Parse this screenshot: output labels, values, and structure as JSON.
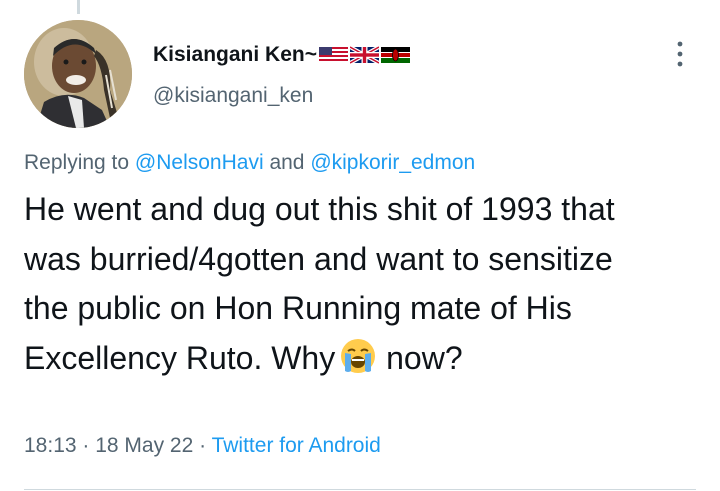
{
  "author": {
    "display_name": "Kisiangani Ken~",
    "handle": "@kisiangani_ken",
    "flags": [
      "us-flag-icon",
      "uk-flag-icon",
      "kenya-flag-icon"
    ]
  },
  "reply": {
    "prefix": "Replying to ",
    "mention_1": "@NelsonHavi",
    "joiner": " and ",
    "mention_2": "@kipkorir_edmon"
  },
  "tweet": {
    "text_before_emoji": "He went and dug out this shit of 1993 that was burried/4gotten and want to sensitize the public on Hon Running mate of His Excellency Ruto. Why",
    "emoji": "loudly-crying-face-icon",
    "text_after_emoji": " now?"
  },
  "meta": {
    "time": "18:13",
    "separator": " · ",
    "date": "18 May 22",
    "source": "Twitter for Android"
  },
  "colors": {
    "link": "#1d9bf0",
    "secondary_text": "#536471",
    "primary_text": "#0f1419",
    "divider": "#cfd9de"
  }
}
